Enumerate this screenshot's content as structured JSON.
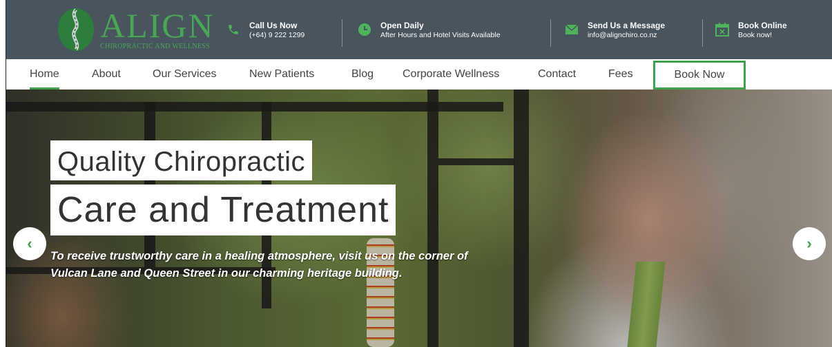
{
  "brand": {
    "name": "ALIGN",
    "tagline": "CHIROPRACTIC AND WELLNESS",
    "accent": "#3fa34d"
  },
  "contacts": [
    {
      "icon": "phone-icon",
      "title": "Call Us Now",
      "detail": "(+64) 9 222 1299"
    },
    {
      "icon": "clock-icon",
      "title": "Open Daily",
      "detail": "After Hours and Hotel Visits Available"
    },
    {
      "icon": "envelope-icon",
      "title": "Send Us a Message",
      "detail": "info@alignchiro.co.nz"
    },
    {
      "icon": "calendar-icon",
      "title": "Book Online",
      "detail": "Book now!"
    }
  ],
  "nav": {
    "items": [
      "Home",
      "About",
      "Our Services",
      "New Patients",
      "Blog",
      "Corporate Wellness",
      "Contact",
      "Fees"
    ],
    "active": "Home",
    "book_button": "Book Now"
  },
  "hero": {
    "headline_line1": "Quality Chiropractic",
    "headline_line2": "Care and Treatment",
    "description": "To receive trustworthy care in a healing atmosphere, visit us on the corner of Vulcan Lane and Queen Street in our charming heritage building.",
    "prev_arrow": "‹",
    "next_arrow": "›"
  }
}
